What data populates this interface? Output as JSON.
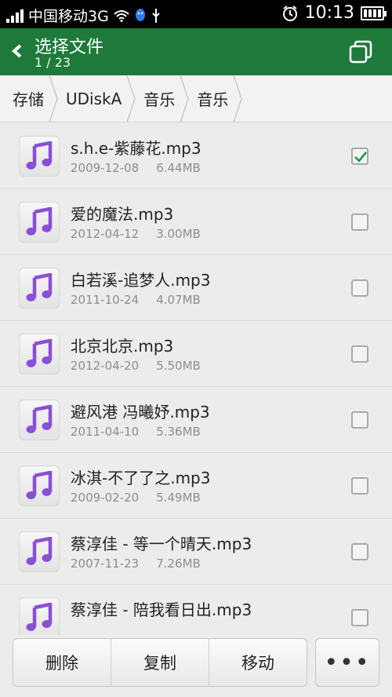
{
  "status_bar": {
    "carrier": "中国移动3G",
    "time": "10:13"
  },
  "header": {
    "back_icon": "chevron-left-icon",
    "title": "选择文件",
    "count": "1 / 23",
    "action_icon": "select-all-icon",
    "accent_color": "#1d7a3a"
  },
  "breadcrumb": [
    {
      "label": "存储"
    },
    {
      "label": "UDiskA"
    },
    {
      "label": "音乐"
    },
    {
      "label": "音乐"
    }
  ],
  "files": [
    {
      "name": "s.h.e-紫藤花.mp3",
      "date": "2009-12-08",
      "size": "6.44MB",
      "checked": true
    },
    {
      "name": "爱的魔法.mp3",
      "date": "2012-04-12",
      "size": "3.00MB",
      "checked": false
    },
    {
      "name": "白若溪-追梦人.mp3",
      "date": "2011-10-24",
      "size": "4.07MB",
      "checked": false
    },
    {
      "name": "北京北京.mp3",
      "date": "2012-04-20",
      "size": "5.50MB",
      "checked": false
    },
    {
      "name": "避风港 冯曦妤.mp3",
      "date": "2011-04-10",
      "size": "5.36MB",
      "checked": false
    },
    {
      "name": "冰淇-不了了之.mp3",
      "date": "2009-02-20",
      "size": "5.49MB",
      "checked": false
    },
    {
      "name": "蔡淳佳 - 等一个晴天.mp3",
      "date": "2007-11-23",
      "size": "7.26MB",
      "checked": false
    },
    {
      "name": "蔡淳佳 - 陪我看日出.mp3",
      "date": "",
      "size": "",
      "checked": false
    }
  ],
  "file_icon": "music-note-icon",
  "file_icon_color": "#8a4fd6",
  "check_color": "#1d9a45",
  "actions": {
    "delete": "删除",
    "copy": "复制",
    "move": "移动",
    "more": "•••"
  }
}
